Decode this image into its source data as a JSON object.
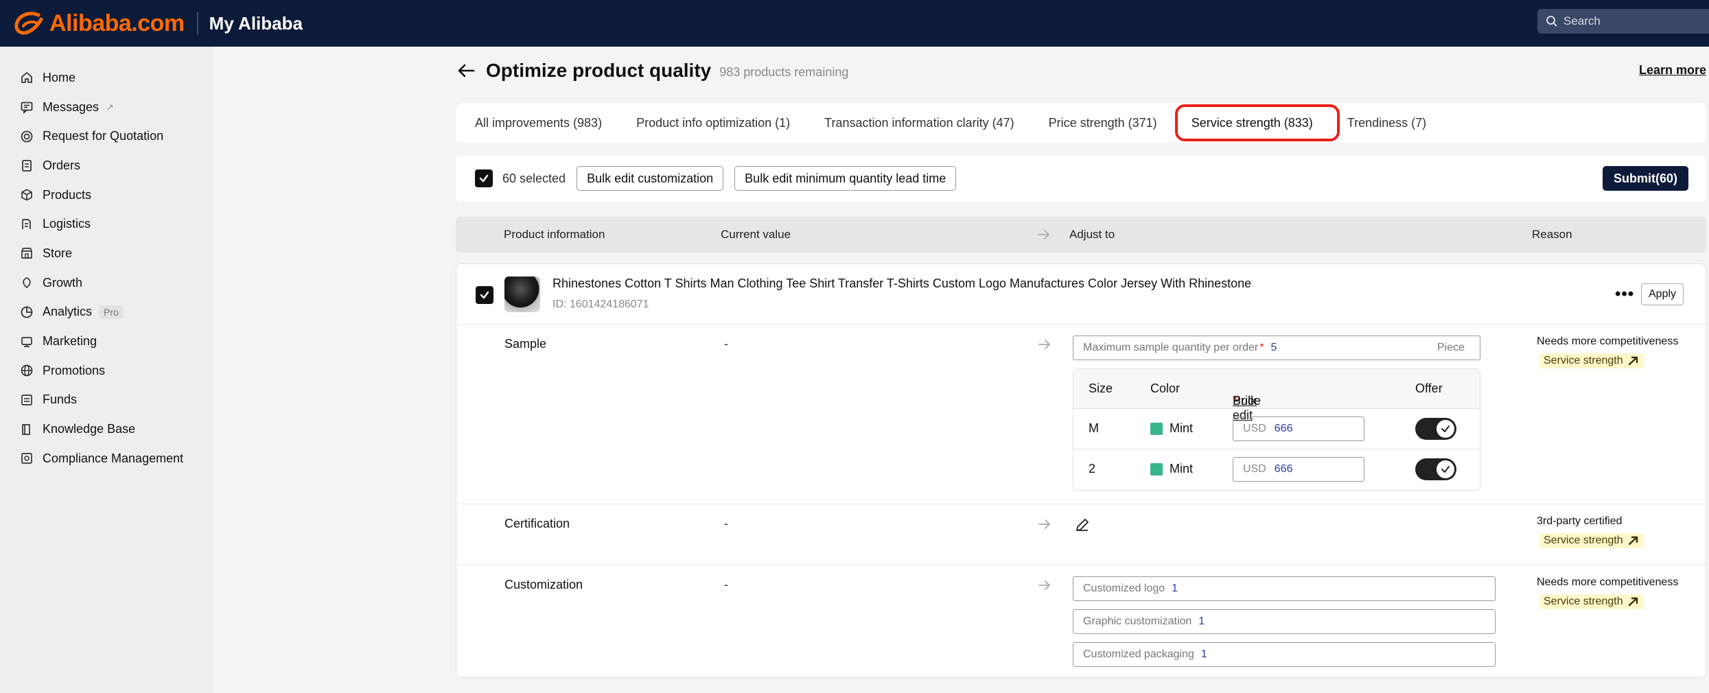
{
  "topbar": {
    "logo_text": "Alibaba.com",
    "section_title": "My Alibaba",
    "search_placeholder": "Search",
    "brand_color": "#ff6a00"
  },
  "sidebar": {
    "items": [
      {
        "label": "Home",
        "icon": "home-icon"
      },
      {
        "label": "Messages",
        "icon": "message-icon",
        "ext": "↗"
      },
      {
        "label": "Request for Quotation",
        "icon": "target-icon"
      },
      {
        "label": "Orders",
        "icon": "clipboard-icon"
      },
      {
        "label": "Products",
        "icon": "box-icon"
      },
      {
        "label": "Logistics",
        "icon": "truck-icon"
      },
      {
        "label": "Store",
        "icon": "store-icon"
      },
      {
        "label": "Growth",
        "icon": "growth-icon"
      },
      {
        "label": "Analytics",
        "icon": "analytics-icon",
        "badge": "Pro"
      },
      {
        "label": "Marketing",
        "icon": "marketing-icon"
      },
      {
        "label": "Promotions",
        "icon": "globe-icon"
      },
      {
        "label": "Funds",
        "icon": "funds-icon"
      },
      {
        "label": "Knowledge Base",
        "icon": "book-icon"
      },
      {
        "label": "Compliance Management",
        "icon": "compliance-icon"
      }
    ]
  },
  "header": {
    "title": "Optimize product quality",
    "remaining": "983 products remaining",
    "learn_more": "Learn more"
  },
  "tabs": [
    {
      "label": "All improvements (983)"
    },
    {
      "label": "Product info optimization (1)"
    },
    {
      "label": "Transaction information clarity (47)"
    },
    {
      "label": "Price strength (371)"
    },
    {
      "label": "Service strength (833)",
      "active": true
    },
    {
      "label": "Trendiness (7)"
    }
  ],
  "toolbar": {
    "selected": "60 selected",
    "bulk_customization": "Bulk edit customization",
    "bulk_moq": "Bulk edit minimum quantity lead time",
    "submit": "Submit(60)"
  },
  "table_head": {
    "product_info": "Product information",
    "current_value": "Current value",
    "adjust_to": "Adjust to",
    "reason": "Reason"
  },
  "product": {
    "title": "Rhinestones Cotton T Shirts Man Clothing Tee Shirt Transfer T-Shirts Custom Logo Manufactures Color Jersey With Rhinestone",
    "id": "ID: 1601424186071",
    "apply": "Apply",
    "sample": {
      "name": "Sample",
      "current": "-",
      "max_label": "Maximum sample quantity per order",
      "max_value": "5",
      "unit": "Piece",
      "table": {
        "size_h": "Size",
        "color_h": "Color",
        "price_h": "Price",
        "bulk_edit": "Bulk edit",
        "offer_h": "Offer",
        "rows": [
          {
            "size": "M",
            "color": "Mint",
            "currency": "USD",
            "price": "666",
            "offer": true
          },
          {
            "size": "2",
            "color": "Mint",
            "currency": "USD",
            "price": "666",
            "offer": true
          }
        ]
      },
      "reason": "Needs more competitiveness",
      "tag": "Service strength"
    },
    "certification": {
      "name": "Certification",
      "current": "-",
      "reason": "3rd-party certified",
      "tag": "Service strength"
    },
    "customization": {
      "name": "Customization",
      "current": "-",
      "fields": [
        {
          "label": "Customized logo",
          "value": "1"
        },
        {
          "label": "Graphic customization",
          "value": "1"
        },
        {
          "label": "Customized packaging",
          "value": "1"
        }
      ],
      "reason": "Needs more competitiveness",
      "tag": "Service strength"
    }
  },
  "colors": {
    "highlight": "#e8201a",
    "swatch_mint": "#39b58a",
    "tag_bg": "#fff7cc"
  }
}
